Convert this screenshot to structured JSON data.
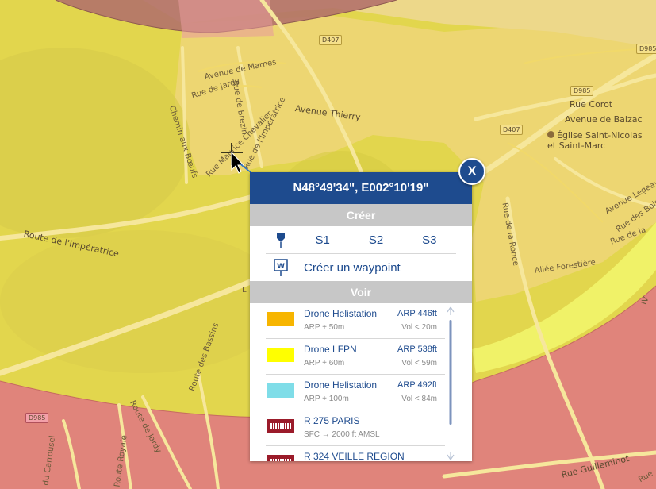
{
  "map": {
    "roads": {
      "d407_a": "D407",
      "d407_b": "D407",
      "d985": "D985",
      "d985_b": "D985",
      "d985_c": "D985"
    },
    "labels": {
      "avenue_marnes": "Avenue de Marnes",
      "rue_jardy": "Rue de Jardy",
      "rue_brezin": "Rue de Brezin",
      "avenue_thierry": "Avenue Thierry",
      "chemin_boeufs": "Chemin aux Bœufs",
      "rue_chevalier": "Rue Maurice Chevalier",
      "rue_imperatrice": "Rue de l'Impératrice",
      "route_imperatrice": "Route de l'Impératrice",
      "rue_corot": "Rue Corot",
      "avenue_balzac": "Avenue de Balzac",
      "rue_ronce": "Rue de la Ronce",
      "allee_forestiere": "Allée Forestière",
      "avenue_legeay": "Avenue Legeay",
      "rue_bois": "Rue des Bois",
      "rue_de_la": "Rue de la",
      "route_jardy": "Route de Jardy",
      "route_bassins": "Route des Bassins",
      "du_carrousel": "du Carrousel",
      "route_royale": "Route Royale",
      "rue_guilleminot": "Rue Guilleminot",
      "rue_end": "Rue",
      "letter_l": "L",
      "letter_iv": "IV"
    },
    "church_line1": "Église Saint-Nicolas",
    "church_line2": "et Saint-Marc"
  },
  "popup": {
    "coordinates": "N48°49'34\", E002°10'19\"",
    "close_label": "X",
    "create_header": "Créer",
    "s1": "S1",
    "s2": "S2",
    "s3": "S3",
    "waypoint_label": "Créer un waypoint",
    "view_header": "Voir",
    "zones": [
      {
        "name": "Drone Helistation",
        "sub": "ARP + 50m",
        "arp": "ARP 446ft",
        "vol": "Vol < 20m",
        "color": "#f7b500"
      },
      {
        "name": "Drone LFPN",
        "sub": "ARP + 60m",
        "arp": "ARP 538ft",
        "vol": "Vol < 59m",
        "color": "#ffff00"
      },
      {
        "name": "Drone Helistation",
        "sub": "ARP + 100m",
        "arp": "ARP 492ft",
        "vol": "Vol < 84m",
        "color": "#7fdde8"
      },
      {
        "name": "R 275 PARIS",
        "sub": "SFC → 2000 ft AMSL",
        "arp": "",
        "vol": "",
        "color": "#9b1b2a"
      },
      {
        "name": "R 324 VEILLE REGION",
        "sub": "",
        "arp": "",
        "vol": "",
        "color": "#9b1b2a"
      }
    ]
  },
  "colors": {
    "accent": "#1e4b8e",
    "zone_yellow": "#e8dc55",
    "zone_red": "#e88a7f",
    "zone_brown": "#b3726a"
  }
}
